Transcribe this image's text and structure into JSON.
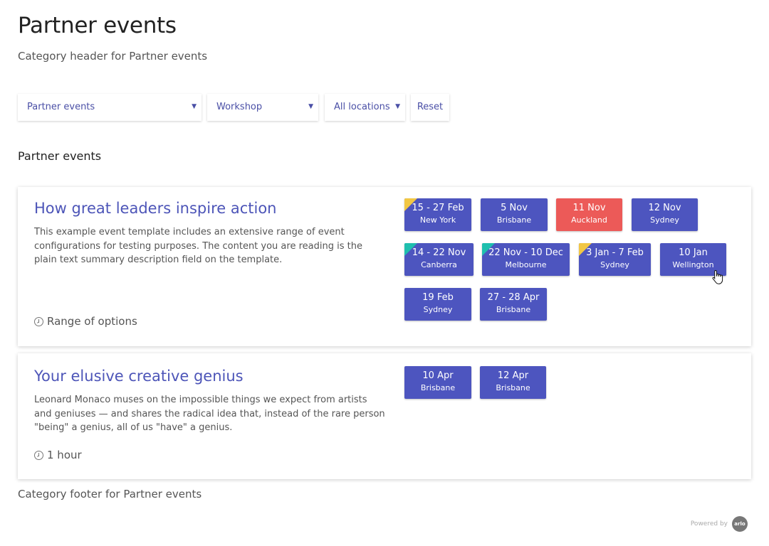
{
  "page": {
    "title": "Partner events",
    "subtitle": "Category header for Partner events",
    "section_heading": "Partner events",
    "footer": "Category footer for Partner events"
  },
  "filters": {
    "category": "Partner events",
    "type": "Workshop",
    "location": "All locations",
    "reset_label": "Reset",
    "arrow": "▼"
  },
  "events": [
    {
      "title": "How great leaders inspire action",
      "description": "This example event template includes an extensive range of event configurations for testing purposes. The content you are reading is the plain text summary description field on the template.",
      "duration": "Range of options",
      "sessions": [
        {
          "date": "15 - 27 Feb",
          "location": "New York",
          "corner": "yellow",
          "status": "available"
        },
        {
          "date": "5 Nov",
          "location": "Brisbane",
          "corner": "",
          "status": "available"
        },
        {
          "date": "11 Nov",
          "location": "Auckland",
          "corner": "",
          "status": "full"
        },
        {
          "date": "12 Nov",
          "location": "Sydney",
          "corner": "",
          "status": "available"
        },
        {
          "date": "14 - 22 Nov",
          "location": "Canberra",
          "corner": "teal",
          "status": "available"
        },
        {
          "date": "22 Nov - 10 Dec",
          "location": "Melbourne",
          "corner": "teal",
          "status": "available"
        },
        {
          "date": "3 Jan - 7 Feb",
          "location": "Sydney",
          "corner": "yellow",
          "status": "available"
        },
        {
          "date": "10 Jan",
          "location": "Wellington",
          "corner": "",
          "status": "available"
        },
        {
          "date": "19 Feb",
          "location": "Sydney",
          "corner": "",
          "status": "available"
        },
        {
          "date": "27 - 28 Apr",
          "location": "Brisbane",
          "corner": "",
          "status": "available"
        }
      ]
    },
    {
      "title": "Your elusive creative genius",
      "description": "Leonard Monaco muses on the impossible things we expect from artists and geniuses — and shares the radical idea that, instead of the rare person \"being\" a genius, all of us \"have\" a genius.",
      "duration": "1 hour",
      "sessions": [
        {
          "date": "10 Apr",
          "location": "Brisbane",
          "corner": "",
          "status": "available"
        },
        {
          "date": "12 Apr",
          "location": "Brisbane",
          "corner": "",
          "status": "available"
        }
      ]
    }
  ],
  "powered_by": {
    "text": "Powered by",
    "logo": "arlo"
  },
  "colors": {
    "accent": "#4d55bf",
    "full": "#ec5a58",
    "corner_yellow": "#f2c744",
    "corner_teal": "#1fbfae"
  }
}
